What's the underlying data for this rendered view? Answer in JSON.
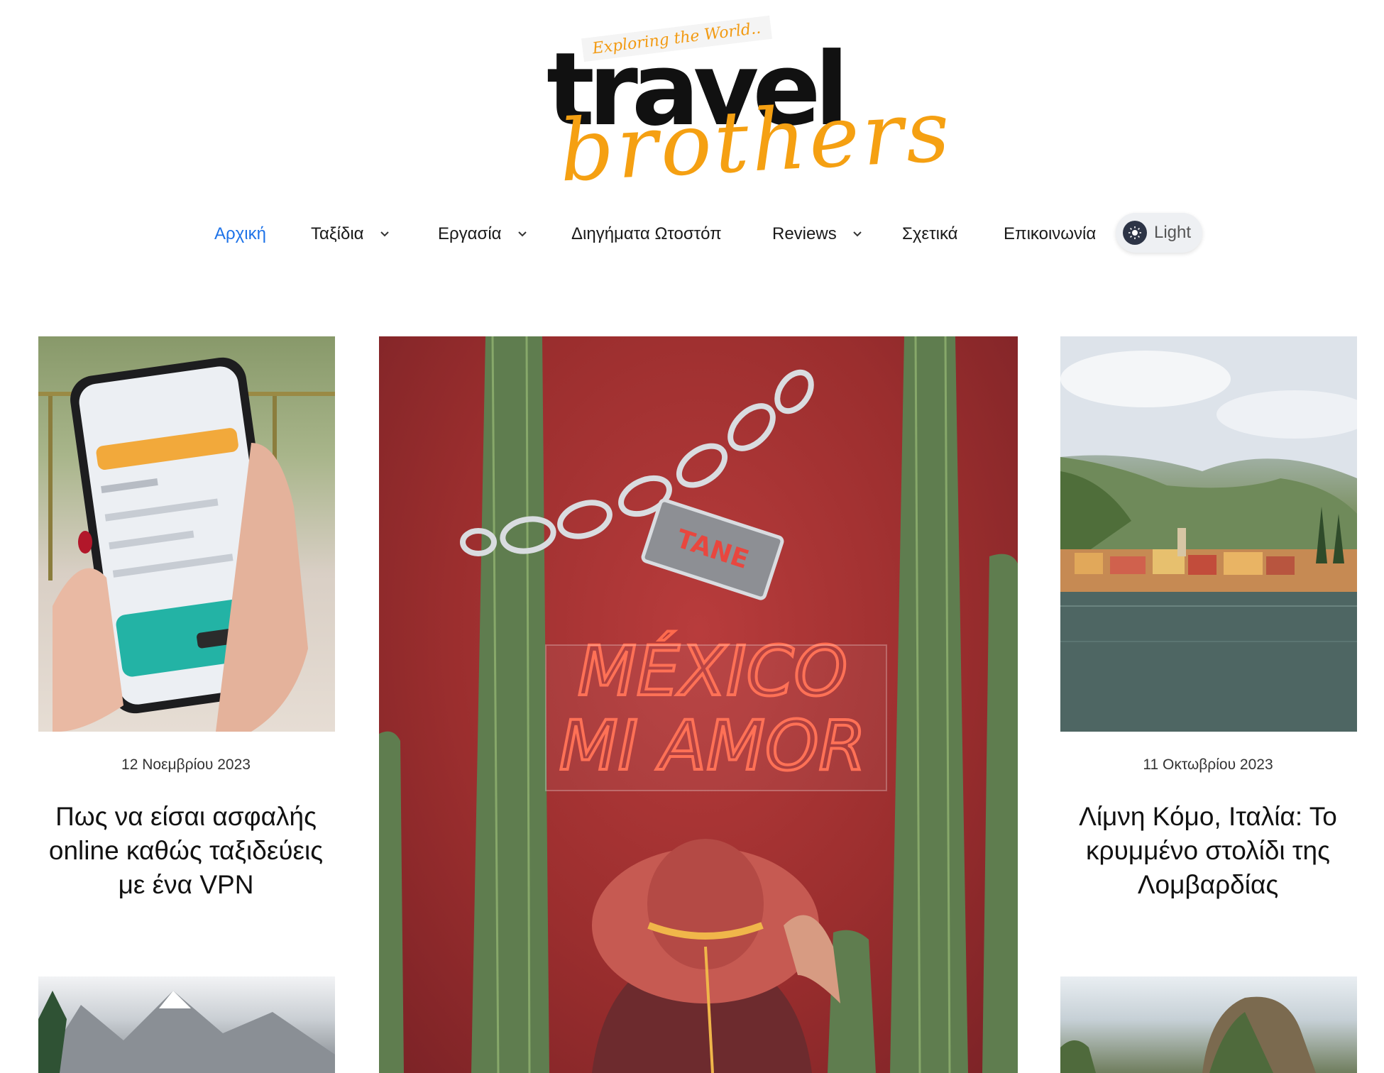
{
  "logo": {
    "tagline": "Exploring the World..",
    "word1": "travel",
    "word2": "brothers"
  },
  "nav": {
    "items": [
      {
        "label": "Αρχική",
        "active": true,
        "dropdown": false
      },
      {
        "label": "Ταξίδια",
        "active": false,
        "dropdown": true
      },
      {
        "label": "Εργασία",
        "active": false,
        "dropdown": true
      },
      {
        "label": "Διηγήματα Ωτοστόπ",
        "active": false,
        "dropdown": false
      },
      {
        "label": "Reviews",
        "active": false,
        "dropdown": true
      },
      {
        "label": "Σχετικά",
        "active": false,
        "dropdown": false
      },
      {
        "label": "Επικοινωνία",
        "active": false,
        "dropdown": false
      }
    ],
    "theme_toggle_label": "Light"
  },
  "posts": {
    "left": {
      "date": "12 Νοεμβρίου 2023",
      "title": "Πως να είσαι ασφαλής online καθώς ταξιδεύεις με ένα VPN"
    },
    "right": {
      "date": "11 Οκτωβρίου 2023",
      "title": "Λίμνη Κόμο, Ιταλία: Το κρυμμένο στολίδι της Λομβαρδίας"
    },
    "featured": {
      "sign_line1": "MÉXICO",
      "sign_line2": "MI AMOR",
      "tag_text": "TANE"
    }
  },
  "colors": {
    "accent": "#1e73e8",
    "logo_orange": "#f5a012",
    "neon": "#ff6a4d"
  }
}
